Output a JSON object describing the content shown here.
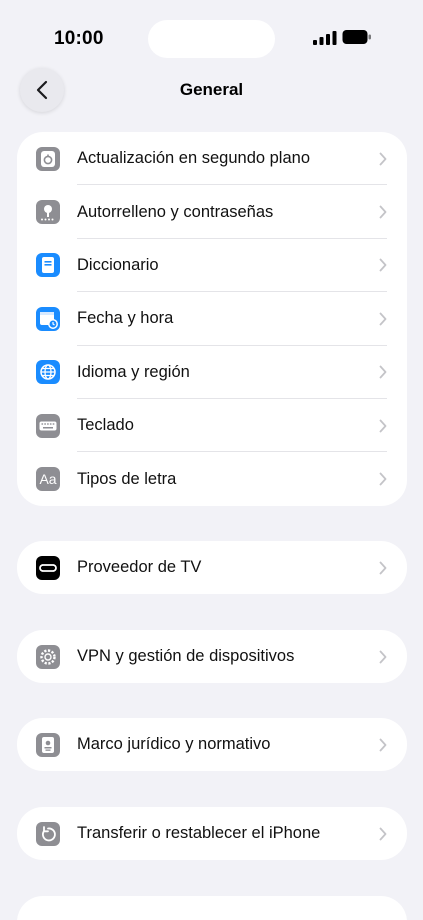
{
  "status": {
    "time": "10:00"
  },
  "nav": {
    "title": "General"
  },
  "group1": [
    {
      "label": "Actualización en segundo plano",
      "icon": "background-refresh-icon"
    },
    {
      "label": "Autorrelleno y contraseñas",
      "icon": "key-icon"
    },
    {
      "label": "Diccionario",
      "icon": "dictionary-icon"
    },
    {
      "label": "Fecha y hora",
      "icon": "calendar-clock-icon"
    },
    {
      "label": "Idioma y región",
      "icon": "globe-icon"
    },
    {
      "label": "Teclado",
      "icon": "keyboard-icon"
    },
    {
      "label": "Tipos de letra",
      "icon": "font-icon",
      "glyph": "Aa"
    }
  ],
  "group2": {
    "label": "Proveedor de TV",
    "icon": "tv-provider-icon"
  },
  "group3": {
    "label": "VPN y gestión de dispositivos",
    "icon": "gear-icon"
  },
  "group4": {
    "label": "Marco jurídico y normativo",
    "icon": "legal-document-icon"
  },
  "group5": {
    "label": "Transferir o restablecer el iPhone",
    "icon": "reset-icon"
  },
  "peek": {
    "label": "..."
  },
  "colors": {
    "background": "#f2f2f7",
    "card": "#ffffff",
    "gray_icon": "#8e8e93",
    "blue_icon": "#1a8cff"
  }
}
